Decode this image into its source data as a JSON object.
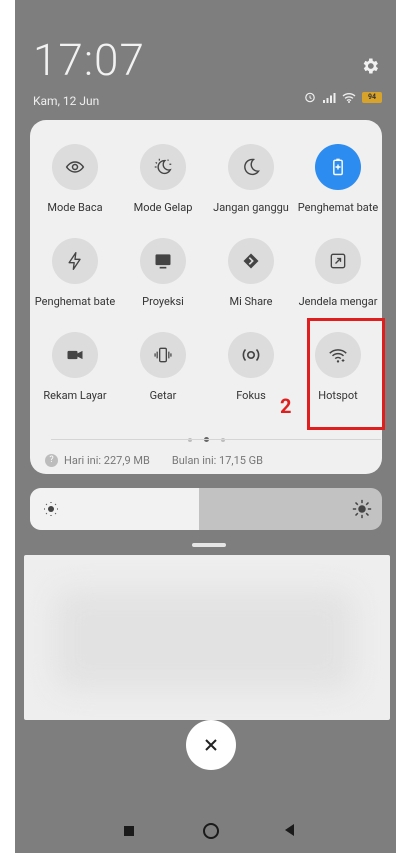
{
  "status": {
    "time": "17:07",
    "date": "Kam, 12 Jun",
    "battery": "94",
    "icons": [
      "alarm-icon",
      "signal-icon",
      "wifi-icon",
      "battery-icon"
    ]
  },
  "tiles": [
    {
      "label": "Mode Baca",
      "icon": "eye-icon",
      "active": false
    },
    {
      "label": "Mode Gelap",
      "icon": "dark-mode-icon",
      "active": false
    },
    {
      "label": "Jangan ganggu",
      "icon": "moon-icon",
      "active": false
    },
    {
      "label": "Penghemat bate",
      "icon": "battery-saver-icon",
      "active": true
    },
    {
      "label": "Penghemat bate",
      "icon": "bolt-icon",
      "active": false
    },
    {
      "label": "Proyeksi",
      "icon": "cast-icon",
      "active": false
    },
    {
      "label": "Mi Share",
      "icon": "mi-share-icon",
      "active": false
    },
    {
      "label": "Jendela mengar",
      "icon": "floating-window-icon",
      "active": false
    },
    {
      "label": "Rekam Layar",
      "icon": "video-icon",
      "active": false
    },
    {
      "label": "Getar",
      "icon": "vibrate-icon",
      "active": false
    },
    {
      "label": "Fokus",
      "icon": "focus-icon",
      "active": false
    },
    {
      "label": "Hotspot",
      "icon": "hotspot-icon",
      "active": false
    }
  ],
  "data_usage": {
    "today": "Hari ini: 227,9 MB",
    "month": "Bulan ini: 17,15 GB"
  },
  "brightness": {
    "level": 0.48
  },
  "annotation": {
    "step": "2"
  },
  "colors": {
    "accent": "#2d8cf0",
    "highlight": "#e01e1e"
  }
}
